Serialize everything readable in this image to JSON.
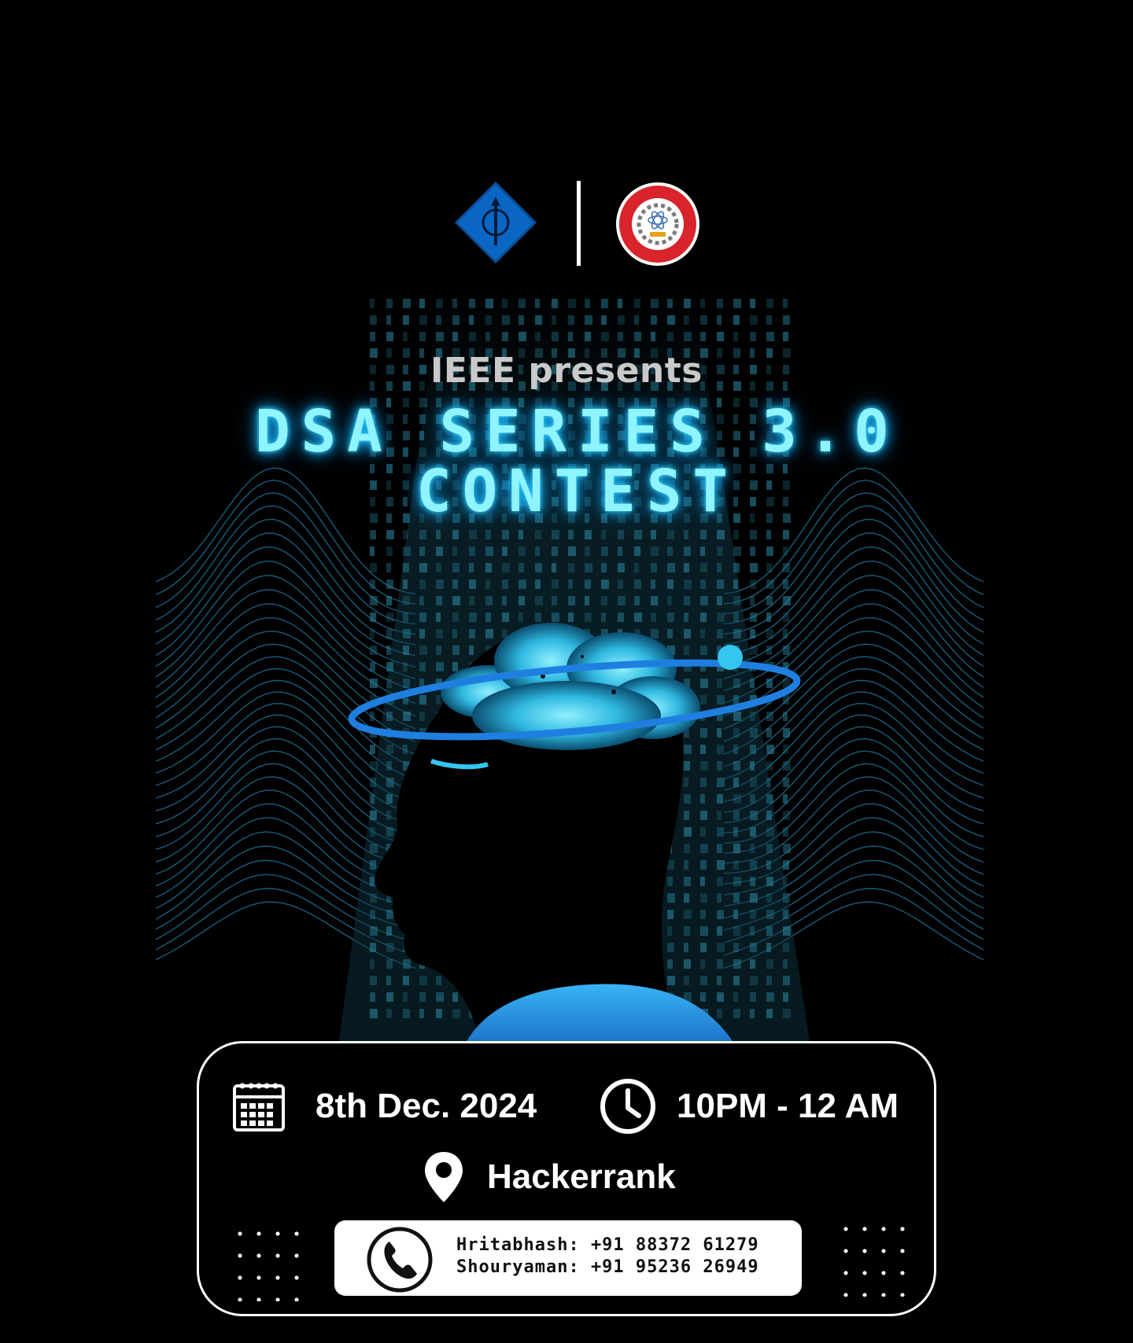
{
  "header": {
    "presents": "IEEE presents",
    "title_line1": "DSA SERIES 3.0",
    "title_line2": "CONTEST"
  },
  "logos": {
    "left": "ieee-logo",
    "right": "institute-seal-logo"
  },
  "event": {
    "date": "8th Dec. 2024",
    "time": "10PM - 12 AM",
    "venue": "Hackerrank"
  },
  "contacts": [
    {
      "line": "Hritabhash: +91 88372 61279"
    },
    {
      "line": "Shouryaman: +91 95236 26949"
    }
  ],
  "icons": {
    "date": "calendar-icon",
    "time": "clock-icon",
    "venue": "location-pin-icon",
    "phone": "phone-icon"
  },
  "colors": {
    "background": "#000000",
    "title_glow": "#8ff4ff",
    "accent_blue": "#1f7fe0",
    "ieee_blue": "#0a66c2",
    "seal_red": "#d8242a"
  }
}
